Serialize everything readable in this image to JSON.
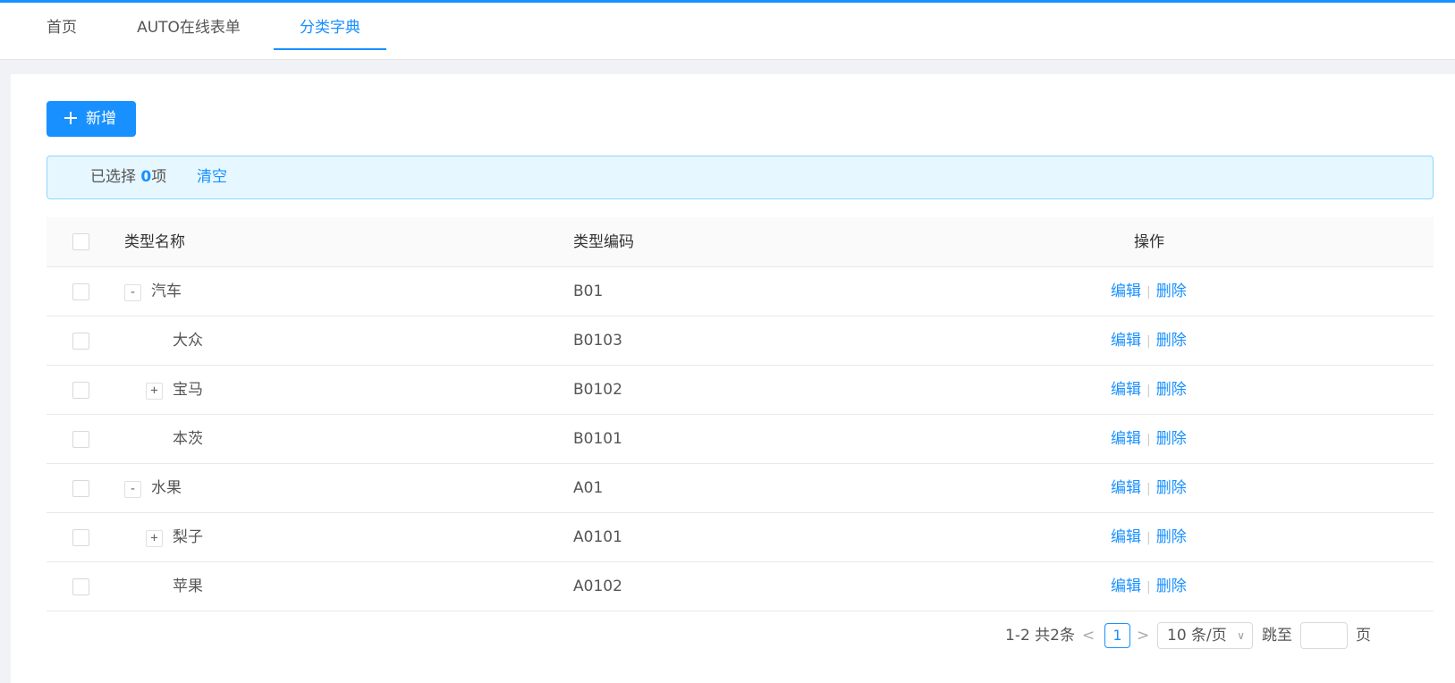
{
  "tabs": [
    {
      "label": "首页",
      "active": false
    },
    {
      "label": "AUTO在线表单",
      "active": false
    },
    {
      "label": "分类字典",
      "active": true
    }
  ],
  "toolbar": {
    "add_label": "新增"
  },
  "alert": {
    "prefix": "已选择 ",
    "count": "0",
    "suffix": "项",
    "clear_label": "清空"
  },
  "table": {
    "headers": {
      "name": "类型名称",
      "code": "类型编码",
      "actions": "操作"
    },
    "rows": [
      {
        "name": "汽车",
        "code": "B01",
        "level": 0,
        "expander": "-"
      },
      {
        "name": "大众",
        "code": "B0103",
        "level": 1,
        "expander": ""
      },
      {
        "name": "宝马",
        "code": "B0102",
        "level": 1,
        "expander": "+"
      },
      {
        "name": "本茨",
        "code": "B0101",
        "level": 1,
        "expander": ""
      },
      {
        "name": "水果",
        "code": "A01",
        "level": 0,
        "expander": "-"
      },
      {
        "name": "梨子",
        "code": "A0101",
        "level": 1,
        "expander": "+"
      },
      {
        "name": "苹果",
        "code": "A0102",
        "level": 1,
        "expander": ""
      }
    ],
    "edit_label": "编辑",
    "delete_label": "删除"
  },
  "pagination": {
    "total_text": "1-2 共2条",
    "current_page": "1",
    "page_size": "10 条/页",
    "jump_label": "跳至",
    "page_word": "页"
  },
  "colors": {
    "accent": "#1890ff",
    "alert_bg": "#e6f7ff"
  }
}
